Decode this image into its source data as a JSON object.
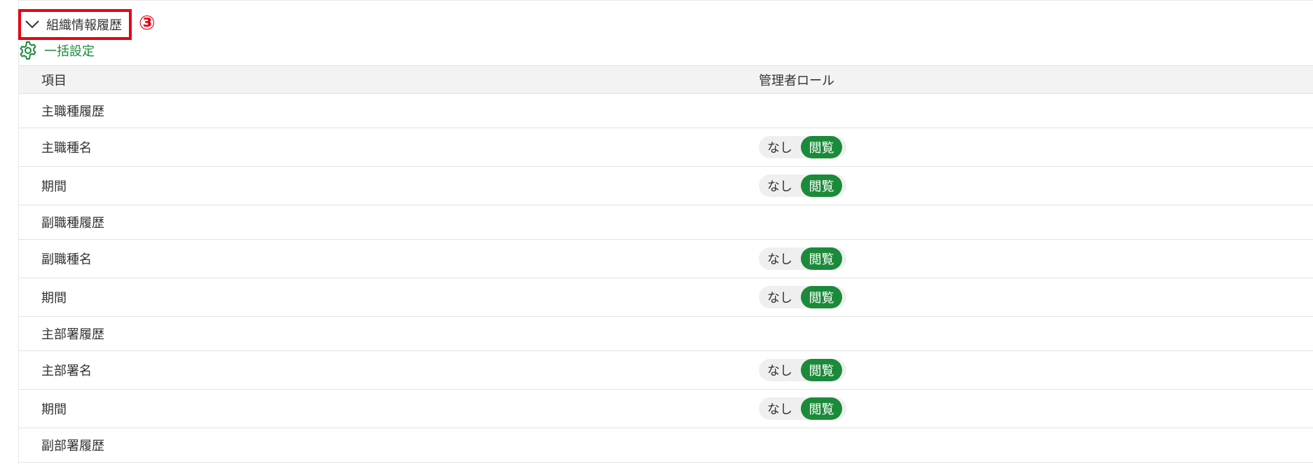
{
  "section": {
    "title": "組織情報履歴",
    "step_marker": "③",
    "bulk_setting_label": "一括設定"
  },
  "table": {
    "headers": {
      "item": "項目",
      "role": "管理者ロール"
    },
    "rows": [
      {
        "label": "主職種履歴",
        "kind": "group"
      },
      {
        "label": "主職種名",
        "kind": "leaf",
        "option_none": "なし",
        "option_view": "閲覧",
        "selected": "閲覧"
      },
      {
        "label": "期間",
        "kind": "leaf",
        "option_none": "なし",
        "option_view": "閲覧",
        "selected": "閲覧"
      },
      {
        "label": "副職種履歴",
        "kind": "group"
      },
      {
        "label": "副職種名",
        "kind": "leaf",
        "option_none": "なし",
        "option_view": "閲覧",
        "selected": "閲覧"
      },
      {
        "label": "期間",
        "kind": "leaf",
        "option_none": "なし",
        "option_view": "閲覧",
        "selected": "閲覧"
      },
      {
        "label": "主部署履歴",
        "kind": "group"
      },
      {
        "label": "主部署名",
        "kind": "leaf",
        "option_none": "なし",
        "option_view": "閲覧",
        "selected": "閲覧"
      },
      {
        "label": "期間",
        "kind": "leaf",
        "option_none": "なし",
        "option_view": "閲覧",
        "selected": "閲覧"
      },
      {
        "label": "副部署履歴",
        "kind": "group"
      }
    ]
  },
  "colors": {
    "accent_green": "#1b8a3a",
    "highlight_red": "#e60012",
    "header_bg": "#f3f3f3"
  },
  "icons": {
    "collapse": "chevron-down-icon",
    "bulk": "gear-icon"
  }
}
